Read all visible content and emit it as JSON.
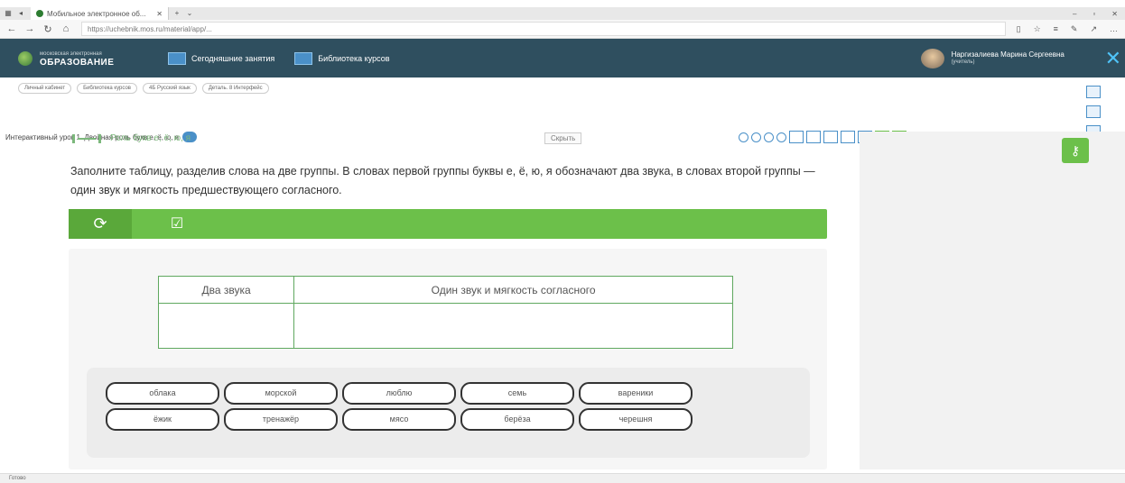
{
  "browser": {
    "tab_title": "Мобильное электронное об...",
    "url": "https://uchebnik.mos.ru/material/app/..."
  },
  "header": {
    "logo_small": "московская электронная",
    "logo_big": "ОБРАЗОВАНИЕ",
    "nav": [
      "Сегодняшние занятия",
      "Библиотека курсов"
    ],
    "user_name": "Наргизалиева Марина Сергеевна",
    "user_role": "(учитель)"
  },
  "breadcrumbs": [
    "Личный кабинет",
    "Библиотека курсов",
    "4Б Русский язык",
    "Деталь. 8 Интерфейс"
  ],
  "lesson_selector": "Интерактивный урок 1. Двойная роль букв е, ё, ю, я",
  "content": {
    "section_title": "Роль букв е, ё, ю, я",
    "hide_label": "Скрыть",
    "task": "Заполните таблицу, разделив слова на две группы. В словах первой группы буквы е, ё, ю, я обозначают два звука, в словах второй группы — один звук и мягкость предшествующего согласного.",
    "table_headers": [
      "Два звука",
      "Один звук и мягкость согласного"
    ],
    "words": [
      "облака",
      "морской",
      "люблю",
      "семь",
      "вареники",
      "ёжик",
      "тренажёр",
      "мясо",
      "берёза",
      "черешня"
    ]
  },
  "status": "Готово"
}
